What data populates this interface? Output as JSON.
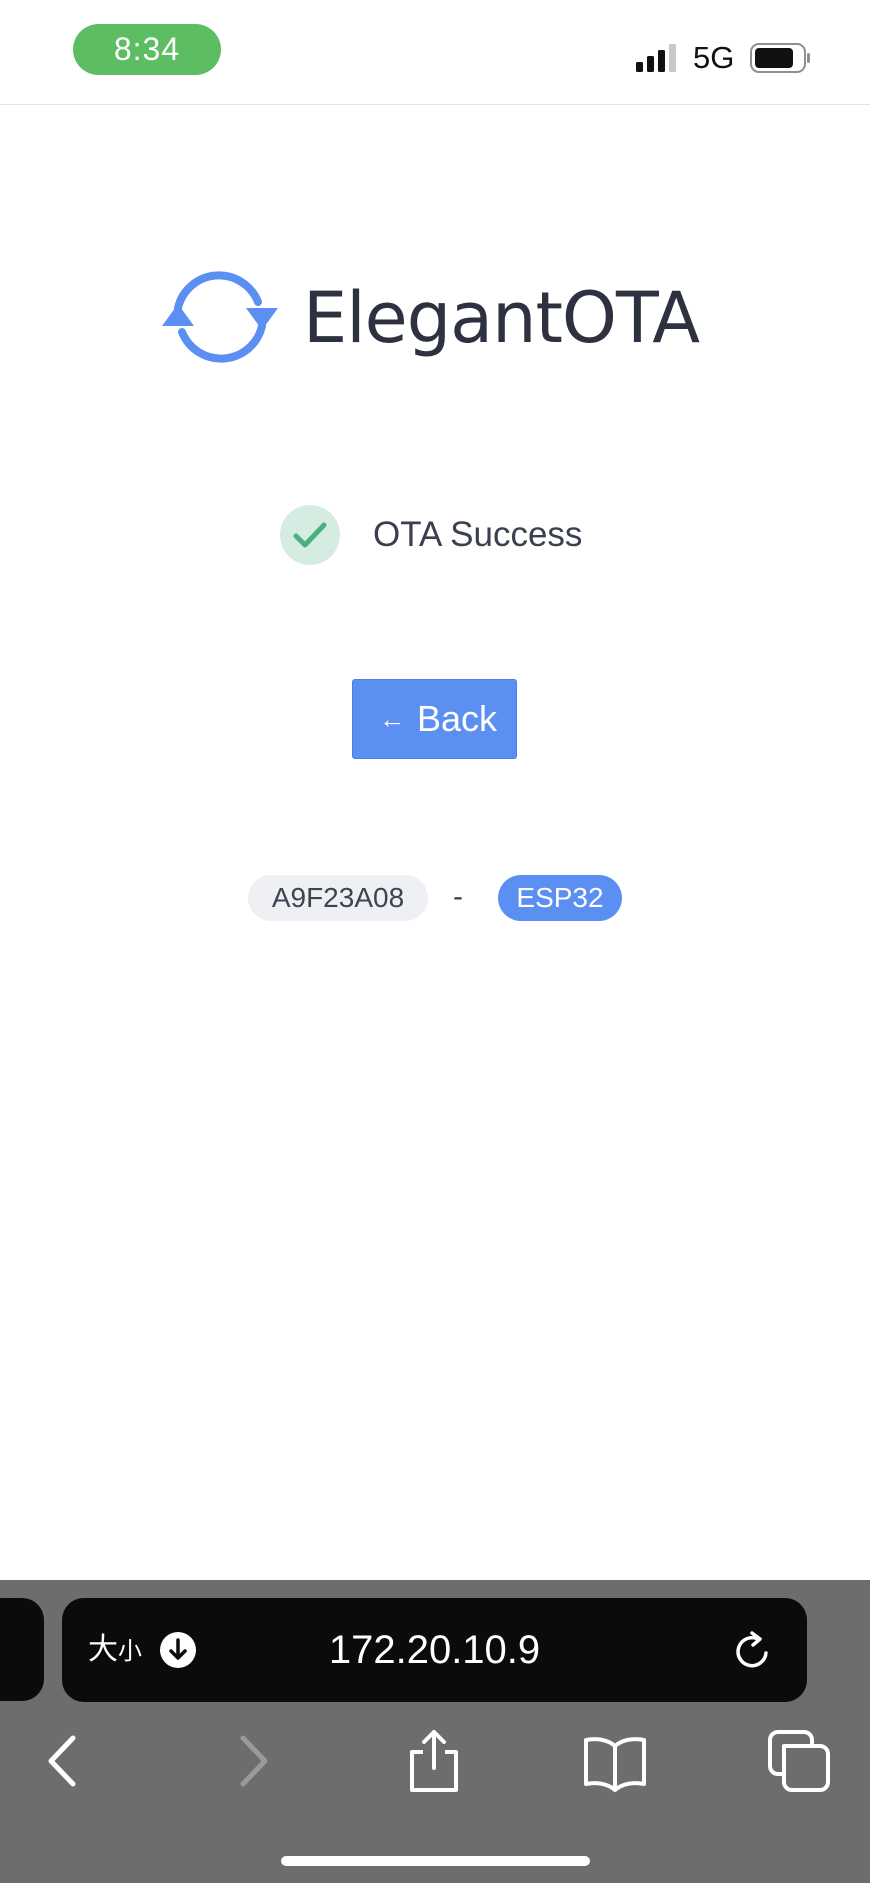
{
  "status_bar": {
    "time": "8:34",
    "network": "5G"
  },
  "header": {
    "logo_text": "ElegantOTA"
  },
  "result": {
    "status_text": "OTA Success"
  },
  "actions": {
    "back_arrow": "←",
    "back_label": "Back"
  },
  "device": {
    "firmware_id": "A9F23A08",
    "separator": "-",
    "hardware": "ESP32"
  },
  "browser": {
    "text_size_label": "大",
    "text_size_small": "小",
    "url": "172.20.10.9"
  },
  "colors": {
    "brand_blue": "#5b8ff2",
    "success_green": "#4caf80",
    "time_pill": "#5cbd63"
  },
  "icons": [
    "signal-icon",
    "battery-icon",
    "sync-logo-icon",
    "check-icon",
    "download-icon",
    "reload-icon",
    "back-nav-icon",
    "forward-nav-icon",
    "share-icon",
    "bookmarks-icon",
    "tabs-icon"
  ]
}
